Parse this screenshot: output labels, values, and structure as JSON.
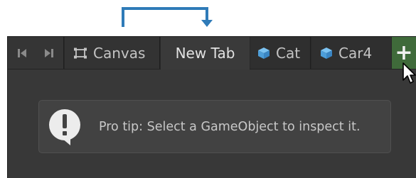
{
  "tabbar": {
    "nav_icons": [
      "step-back-icon",
      "step-forward-icon"
    ],
    "tabs": [
      {
        "label": "Canvas",
        "icon": "rect-transform-icon",
        "active": false
      },
      {
        "label": "New Tab",
        "icon": "",
        "active": true
      },
      {
        "label": "Cat",
        "icon": "prefab-cube-icon",
        "active": false
      },
      {
        "label": "Car4",
        "icon": "prefab-cube-icon",
        "active": false
      }
    ],
    "add_label": "+"
  },
  "tip": {
    "text": "Pro tip: Select a GameObject to inspect it.",
    "icon": "exclamation-speech-icon"
  },
  "colors": {
    "panel_bg": "#383838",
    "tabbar_bg": "#282828",
    "active_tab_bg": "#3a3a3a",
    "add_button_bg": "#3f6a3a",
    "prefab_icon": "#5aaee8",
    "annotation_arrow": "#2f7bb8"
  }
}
